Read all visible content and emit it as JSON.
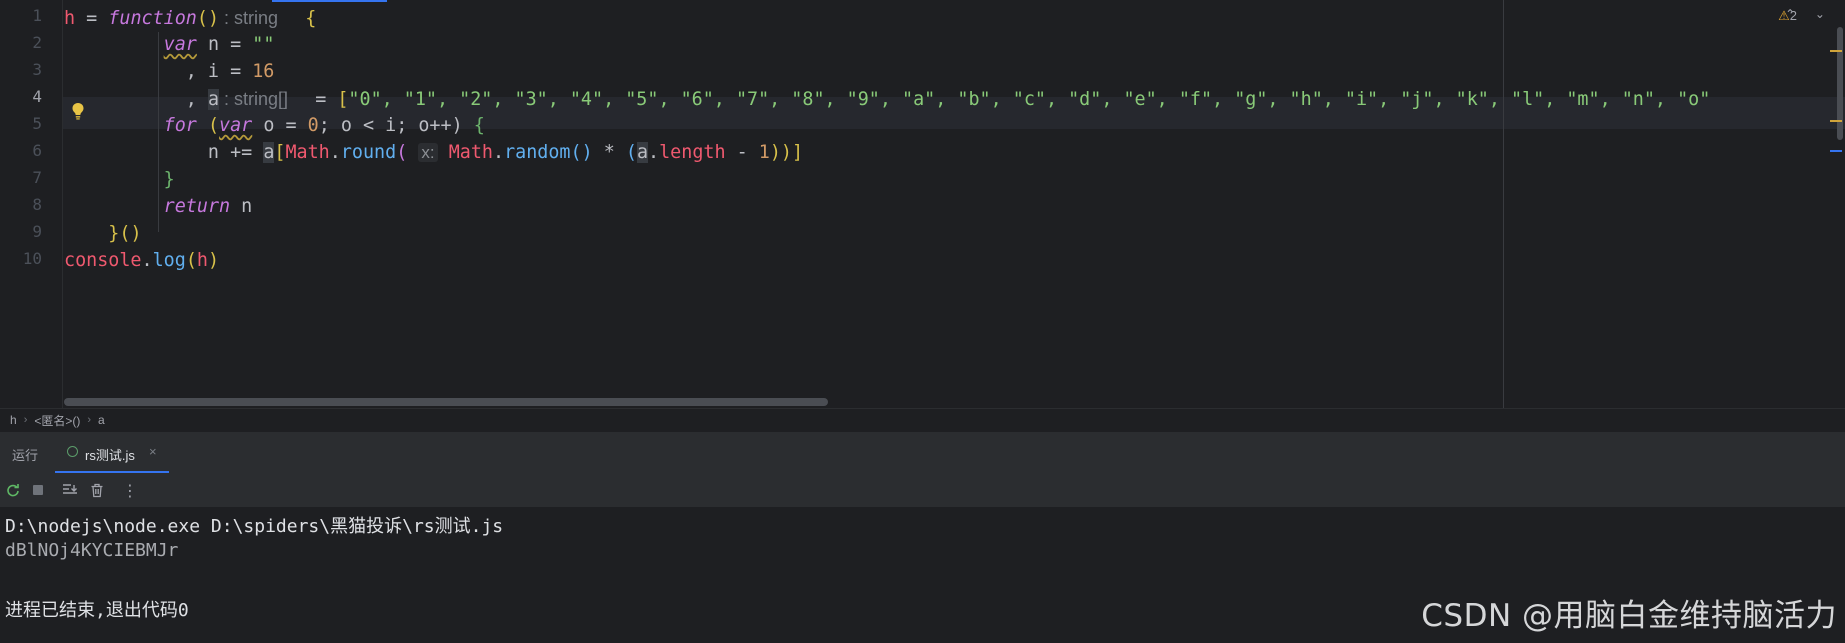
{
  "editor": {
    "line_numbers": [
      "1",
      "2",
      "3",
      "4",
      "5",
      "6",
      "7",
      "8",
      "9",
      "10"
    ],
    "current_line": "4",
    "lines": {
      "l1": {
        "var": "h",
        "eq": " = ",
        "func": "function",
        "parens": "()",
        "hint": " : string ",
        "brace": "  {"
      },
      "l2": {
        "indent": "         ",
        "kw": "var",
        "rest": " n = ",
        "str": "\"\""
      },
      "l3": {
        "indent": "           , i = ",
        "num": "16"
      },
      "l4": {
        "indent": "           , ",
        "name": "a",
        "hint": " : string[] ",
        "eq": "  = ",
        "open": "[",
        "items": "\"0\", \"1\", \"2\", \"3\", \"4\", \"5\", \"6\", \"7\", \"8\", \"9\", \"a\", \"b\", \"c\", \"d\", \"e\", \"f\", \"g\", \"h\", \"i\", \"j\", \"k\", \"l\", \"m\", \"n\", \"o\""
      },
      "l5": {
        "indent": "         ",
        "kw": "for",
        "p1": " (",
        "kw2": "var",
        "p2": " o = ",
        "zero": "0",
        "p3": "; o < i; o++) ",
        "brace": "{"
      },
      "l6": {
        "indent": "             n += ",
        "a": "a",
        "br": "[",
        "math1": "Math",
        "dot": ".",
        "round": "round",
        "paren": "(",
        "hint": "x:",
        "math2": "Math",
        "random": "random",
        "rparen": "()",
        "mult": " * ",
        "op": "(",
        "a2": "a",
        "len": "length",
        "minus": " - ",
        "one": "1",
        "close": "))]"
      },
      "l7": {
        "indent": "         ",
        "brace": "}"
      },
      "l8": {
        "indent": "         ",
        "kw": "return",
        "rest": " n"
      },
      "l9": {
        "indent": "    ",
        "close": "}",
        "call": "()"
      },
      "l10": {
        "obj": "console",
        "dot": ".",
        "fn": "log",
        "open": "(",
        "arg": "h",
        "close": ")"
      }
    },
    "warnings": {
      "count": "2",
      "arrows": "⌃ ⌄"
    }
  },
  "breadcrumb": {
    "items": [
      "h",
      "<匿名>()",
      "a"
    ]
  },
  "run_window": {
    "title": "运行",
    "tab_label": "rs测试.js",
    "tab_close": "×"
  },
  "console": {
    "command": "D:\\nodejs\\node.exe D:\\spiders\\黑猫投诉\\rs测试.js",
    "stdout": "dBlNOj4KYCIEBMJr",
    "exit": "进程已结束,退出代码0"
  },
  "watermark": "CSDN @用脑白金维持脑活力"
}
